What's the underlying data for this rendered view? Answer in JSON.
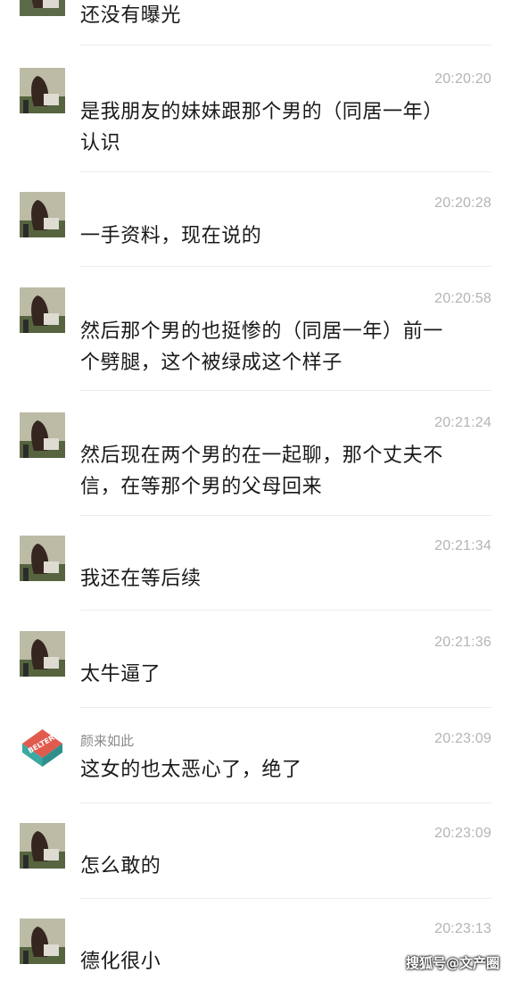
{
  "messages": [
    {
      "time": "",
      "text": "还没有曝光"
    },
    {
      "time": "20:20:20",
      "text": "是我朋友的妹妹跟那个男的（同居一年）\n认识"
    },
    {
      "time": "20:20:28",
      "text": "一手资料，现在说的"
    },
    {
      "time": "20:20:58",
      "text": "然后那个男的也挺惨的（同居一年）前一\n个劈腿，这个被绿成这个样子"
    },
    {
      "time": "20:21:24",
      "text": "然后现在两个男的在一起聊，那个丈夫不\n信，在等那个男的父母回来"
    },
    {
      "time": "20:21:34",
      "text": "我还在等后续"
    },
    {
      "time": "20:21:36",
      "text": "太牛逼了"
    },
    {
      "sender": "颜来如此",
      "time": "20:23:09",
      "text": "这女的也太恶心了，绝了",
      "avatar_text": "BELTER"
    },
    {
      "time": "20:23:09",
      "text": "怎么敢的"
    },
    {
      "time": "20:23:13",
      "text": "德化很小"
    }
  ],
  "watermark": "搜狐号@文产圈"
}
